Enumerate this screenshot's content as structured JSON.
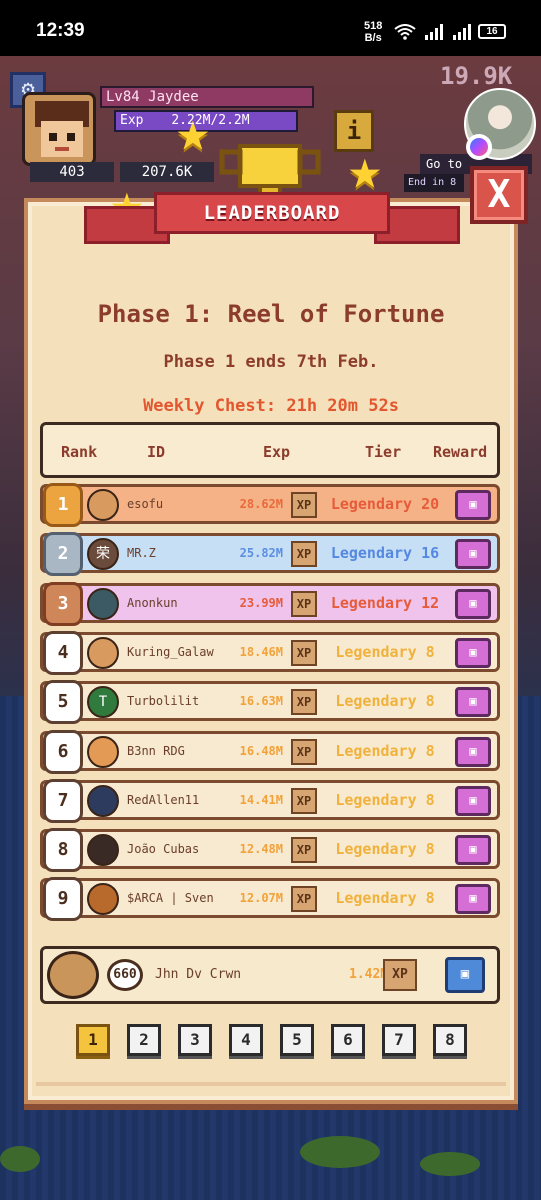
{
  "statusbar": {
    "time": "12:39",
    "speed_value": "518",
    "speed_unit": "B/s",
    "battery": "16"
  },
  "hud": {
    "level_text": "Lv84 Jaydee",
    "exp_label": "Exp",
    "exp_value": "2.22M/2.2M",
    "exp_fraction": 1.0,
    "coins": "403",
    "gems": "207.6K",
    "info_label": "i",
    "goto_label": "Go to",
    "end_in_label": "End in 8",
    "score_text": "19.9K"
  },
  "panel": {
    "header": "LEADERBOARD",
    "close_label": "X",
    "phase_title": "Phase 1: Reel of Fortune",
    "phase_subtitle": "Phase 1 ends 7th Feb.",
    "weekly_chest": "Weekly Chest: 21h 20m 52s",
    "columns": {
      "rank": "Rank",
      "id": "ID",
      "exp": "Exp",
      "tier": "Tier",
      "reward": "Reward"
    }
  },
  "rows": [
    {
      "rank": "1",
      "name": "esofu",
      "exp": "28.62M",
      "xp": "XP",
      "tier": "Legendary 20",
      "row_color": "#f6b287",
      "tier_color": "#e65c3b",
      "exp_color": "#ea6a3b",
      "badge": "gold",
      "avatar_color": "#d89a5e",
      "avatar_glyph": ""
    },
    {
      "rank": "2",
      "name": "MR.Z",
      "exp": "25.82M",
      "xp": "XP",
      "tier": "Legendary 16",
      "row_color": "#c7dff5",
      "tier_color": "#5588e0",
      "exp_color": "#5b8fe2",
      "badge": "silver",
      "avatar_color": "#6b4b3b",
      "avatar_glyph": "荣"
    },
    {
      "rank": "3",
      "name": "Anonkun",
      "exp": "23.99M",
      "xp": "XP",
      "tier": "Legendary 12",
      "row_color": "#efc3ec",
      "tier_color": "#e65c3b",
      "exp_color": "#e65c3b",
      "badge": "bronze",
      "avatar_color": "#3c5a63",
      "avatar_glyph": ""
    },
    {
      "rank": "4",
      "name": "Kuring_Galaw",
      "exp": "18.46M",
      "xp": "XP",
      "tier": "Legendary 8",
      "row_color": "#f8ead0",
      "tier_color": "#f0b23c",
      "exp_color": "#f2a23a",
      "badge": "plain",
      "avatar_color": "#d89a5e",
      "avatar_glyph": ""
    },
    {
      "rank": "5",
      "name": "Turbolilit",
      "exp": "16.63M",
      "xp": "XP",
      "tier": "Legendary 8",
      "row_color": "#f8ead0",
      "tier_color": "#f0b23c",
      "exp_color": "#f2a23a",
      "badge": "plain",
      "avatar_color": "#2f7a3c",
      "avatar_glyph": "T"
    },
    {
      "rank": "6",
      "name": "B3nn RDG",
      "exp": "16.48M",
      "xp": "XP",
      "tier": "Legendary 8",
      "row_color": "#f8ead0",
      "tier_color": "#f0b23c",
      "exp_color": "#f2a23a",
      "badge": "plain",
      "avatar_color": "#e39a55",
      "avatar_glyph": ""
    },
    {
      "rank": "7",
      "name": "RedAllen11",
      "exp": "14.41M",
      "xp": "XP",
      "tier": "Legendary 8",
      "row_color": "#f8ead0",
      "tier_color": "#f0b23c",
      "exp_color": "#f2a23a",
      "badge": "plain",
      "avatar_color": "#2d3c5e",
      "avatar_glyph": ""
    },
    {
      "rank": "8",
      "name": "João Cubas",
      "exp": "12.48M",
      "xp": "XP",
      "tier": "Legendary 8",
      "row_color": "#f8ead0",
      "tier_color": "#f0b23c",
      "exp_color": "#f2a23a",
      "badge": "plain",
      "avatar_color": "#3a2a26",
      "avatar_glyph": ""
    },
    {
      "rank": "9",
      "name": "$ARCA | Sven",
      "exp": "12.07M",
      "xp": "XP",
      "tier": "Legendary 8",
      "row_color": "#f8ead0",
      "tier_color": "#f0b23c",
      "exp_color": "#f2a23a",
      "badge": "plain",
      "avatar_color": "#b8692c",
      "avatar_glyph": ""
    }
  ],
  "me": {
    "rank": "660",
    "name": "Jhn Dv Crwn",
    "exp": "1.42M",
    "xp": "XP"
  },
  "pager": {
    "pages": [
      "1",
      "2",
      "3",
      "4",
      "5",
      "6",
      "7",
      "8"
    ],
    "active": "1"
  }
}
